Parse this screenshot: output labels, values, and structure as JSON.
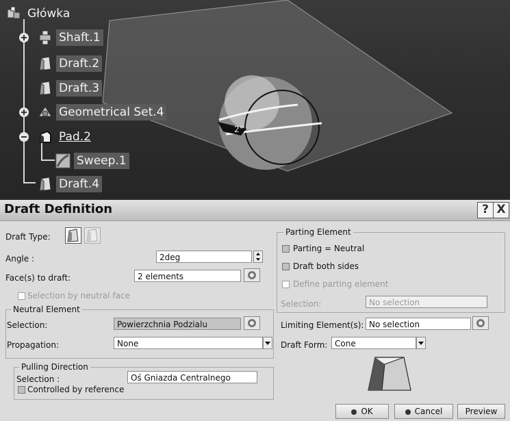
{
  "tree": {
    "root": "Główka",
    "items": [
      "Shaft.1",
      "Draft.2",
      "Draft.3",
      "Geometrical Set.4",
      "Pad.2",
      "Sweep.1",
      "Draft.4"
    ]
  },
  "viewport": {
    "angle_annotation": "2°"
  },
  "dialog": {
    "title": "Draft Definition",
    "help_label": "?",
    "close_label": "X",
    "draft_type_label": "Draft Type:",
    "angle_label": "Angle :",
    "angle_value": "2deg",
    "faces_label": "Face(s) to draft:",
    "faces_value": "2 elements",
    "selection_by_neutral_face": "Selection by neutral face",
    "neutral_element": {
      "title": "Neutral Element",
      "selection_label": "Selection:",
      "selection_value": "Powierzchnia Podzialu",
      "propagation_label": "Propagation:",
      "propagation_value": "None"
    },
    "pulling_direction": {
      "title": "Pulling Direction",
      "selection_label": "Selection :",
      "selection_value": "Oś Gniazda Centralnego",
      "controlled_by_reference": "Controlled by reference"
    },
    "parting_element": {
      "title": "Parting Element",
      "parting_neutral": "Parting = Neutral",
      "draft_both_sides": "Draft both sides",
      "define_parting_element": "Define parting element",
      "selection_label": "Selection:",
      "selection_value": "No selection"
    },
    "limiting_label": "Limiting Element(s):",
    "limiting_value": "No selection",
    "draft_form_label": "Draft Form:",
    "draft_form_value": "Cone",
    "ok_label": "OK",
    "cancel_label": "Cancel",
    "preview_label": "Preview"
  }
}
